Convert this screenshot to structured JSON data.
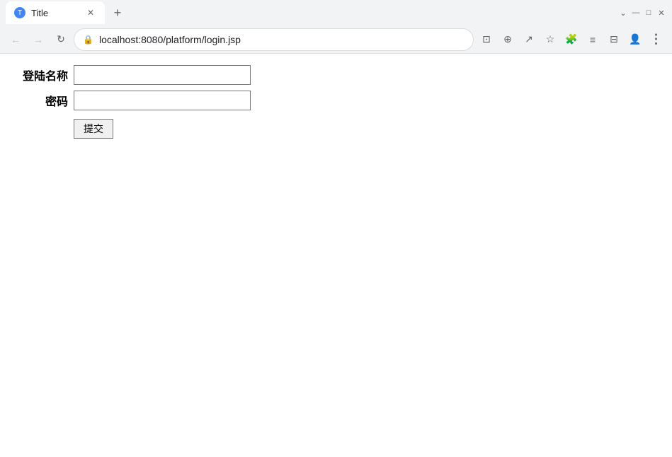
{
  "browser": {
    "tab": {
      "title": "Title",
      "favicon_color": "#4285f4",
      "favicon_label": "T"
    },
    "new_tab_icon": "+",
    "window_controls": {
      "minimize": "—",
      "maximize": "□",
      "close": "✕",
      "chevron": "⌄"
    },
    "address_bar": {
      "url": "localhost:8080/platform/login.jsp",
      "lock_icon": "🔒",
      "back_icon": "←",
      "forward_icon": "→",
      "reload_icon": "↻"
    },
    "toolbar": {
      "screenshot_icon": "⊡",
      "zoom_icon": "⊕",
      "share_icon": "↗",
      "star_icon": "☆",
      "extension_icon": "🧩",
      "readinglist_icon": "≡",
      "split_icon": "⊟",
      "profile_icon": "👤",
      "more_icon": "⋮"
    }
  },
  "form": {
    "username_label": "登陆名称",
    "password_label": "密码",
    "submit_label": "提交",
    "username_placeholder": "",
    "password_placeholder": ""
  }
}
